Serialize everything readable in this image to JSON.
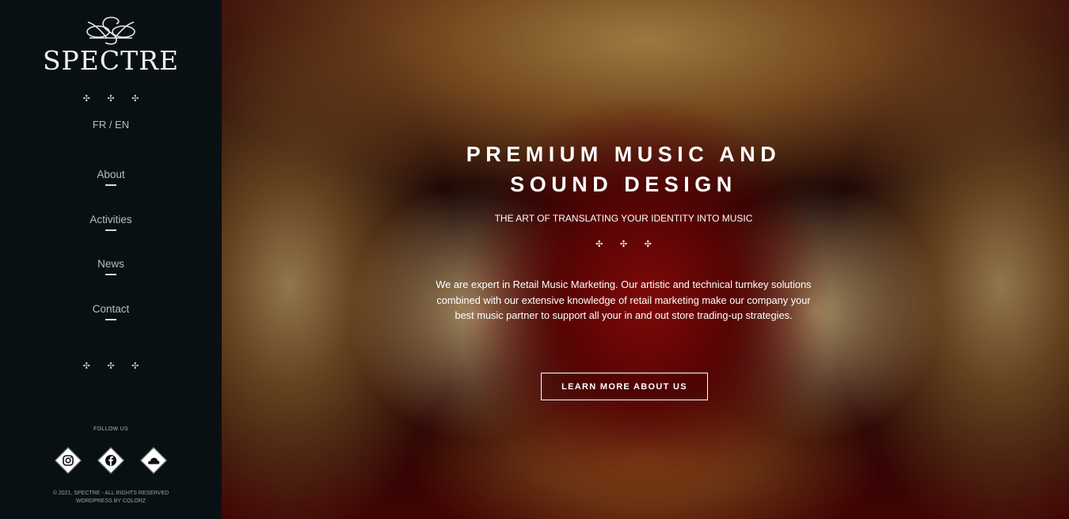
{
  "brand": {
    "name": "SPECTRE",
    "logo_icon": "spectre-monogram"
  },
  "ornament_glyphs": "✣ ✣ ✣",
  "language": {
    "label": "FR / EN"
  },
  "nav": {
    "items": [
      {
        "label": "About"
      },
      {
        "label": "Activities"
      },
      {
        "label": "News"
      },
      {
        "label": "Contact"
      }
    ]
  },
  "follow": {
    "label": "FOLLOW US"
  },
  "socials": [
    {
      "icon": "instagram-icon"
    },
    {
      "icon": "facebook-icon"
    },
    {
      "icon": "soundcloud-icon"
    }
  ],
  "footer": {
    "line1": "© 2021, SPECTRE - ALL RIGHTS RESERVED",
    "line2": "WORDPRESS BY COLORZ"
  },
  "hero": {
    "title_line1": "PREMIUM MUSIC AND",
    "title_line2": "SOUND DESIGN",
    "subtitle": "THE ART OF TRANSLATING YOUR IDENTITY INTO MUSIC",
    "body": "We are expert in Retail Music Marketing. Our artistic and technical turnkey solutions combined with our extensive knowledge of retail marketing make our company your best music partner to support all your in and out store trading-up strategies.",
    "cta_label": "LEARN MORE ABOUT US"
  },
  "colors": {
    "sidebar_bg": "#091014",
    "nav_text": "#b9bec2",
    "hero_text": "#ffffff"
  }
}
